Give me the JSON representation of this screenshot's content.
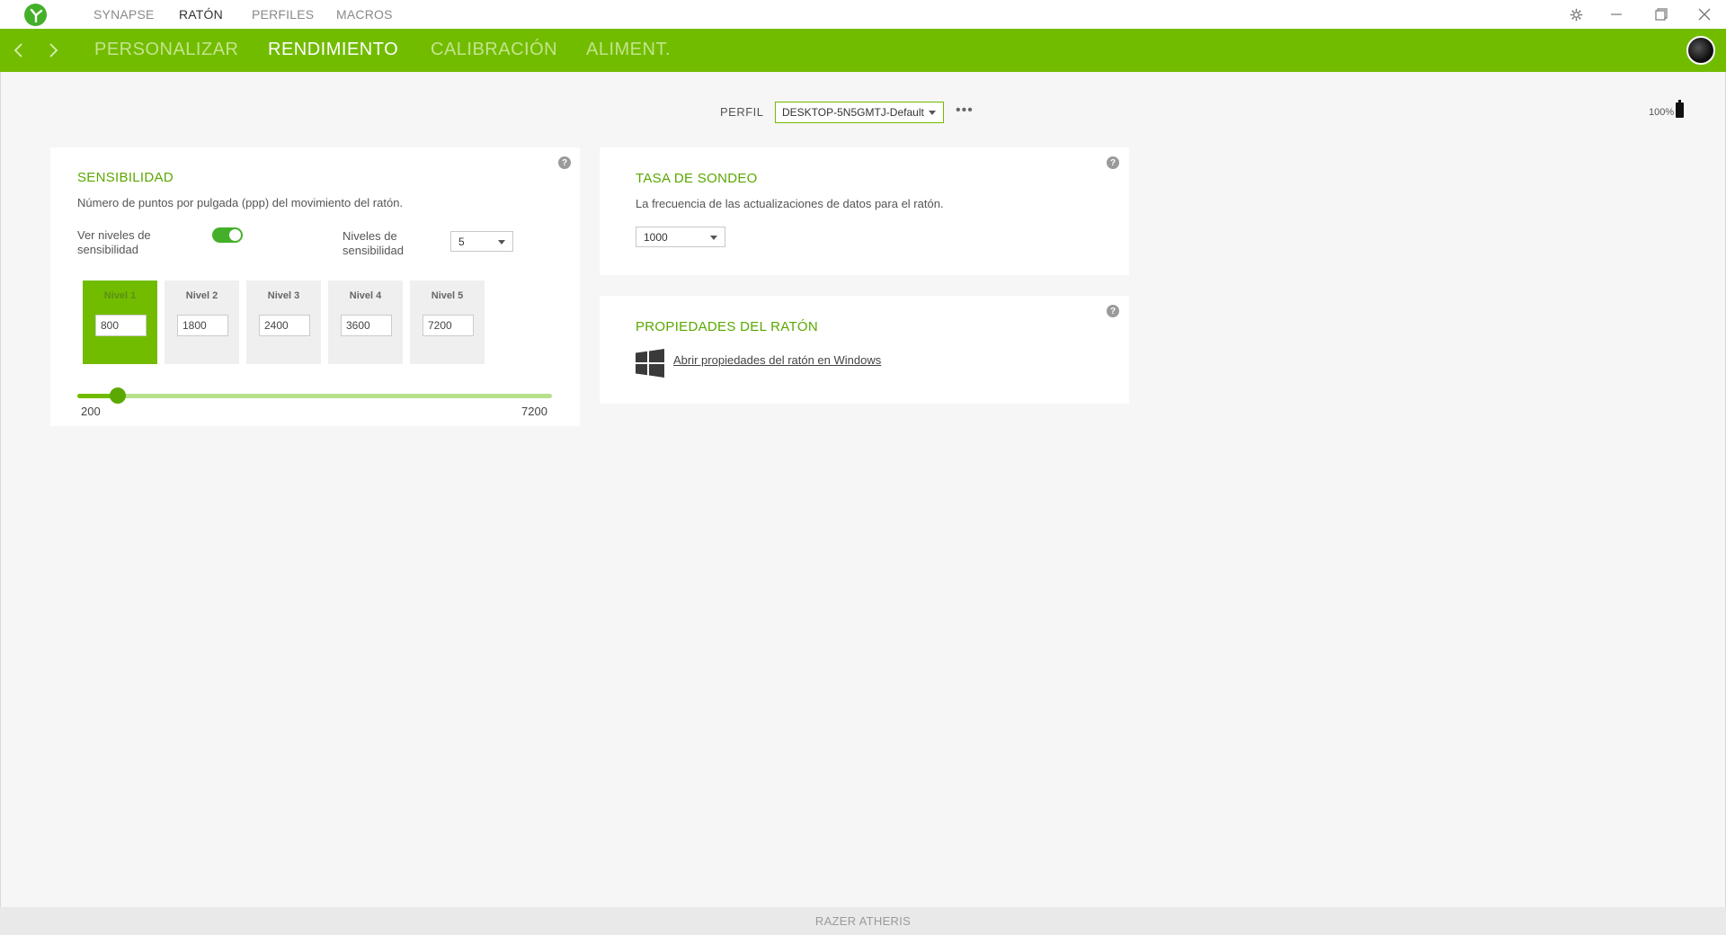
{
  "titlebar": {
    "nav": [
      {
        "label": "SYNAPSE",
        "active": false
      },
      {
        "label": "RATÓN",
        "active": true
      },
      {
        "label": "PERFILES",
        "active": false
      },
      {
        "label": "MACROS",
        "active": false
      }
    ],
    "icons": [
      "razer-logo-icon",
      "gear-icon",
      "minimize-icon",
      "restore-icon",
      "close-icon"
    ]
  },
  "header": {
    "tabs": [
      {
        "label": "PERSONALIZAR",
        "active": false
      },
      {
        "label": "RENDIMIENTO",
        "active": true
      },
      {
        "label": "CALIBRACIÓN",
        "active": false
      },
      {
        "label": "ALIMENT.",
        "active": false
      }
    ]
  },
  "profile": {
    "label": "PERFIL",
    "value": "DESKTOP-5N5GMTJ-Default",
    "more": "•••",
    "battery": "100%"
  },
  "sensitivity": {
    "title": "SENSIBILIDAD",
    "description": "Número de puntos por pulgada (ppp) del movimiento del ratón.",
    "toggle_label_1": "Ver niveles de",
    "toggle_label_2": "sensibilidad",
    "toggle_on": true,
    "levels_label_1": "Niveles de",
    "levels_label_2": "sensibilidad",
    "levels_count": "5",
    "levels": [
      {
        "label": "Nivel 1",
        "value": "800",
        "active": true
      },
      {
        "label": "Nivel 2",
        "value": "1800",
        "active": false
      },
      {
        "label": "Nivel 3",
        "value": "2400",
        "active": false
      },
      {
        "label": "Nivel 4",
        "value": "3600",
        "active": false
      },
      {
        "label": "Nivel 5",
        "value": "7200",
        "active": false
      }
    ],
    "slider": {
      "min": "200",
      "max": "7200",
      "min_value": 200,
      "max_value": 7200,
      "current": 800
    }
  },
  "polling": {
    "title": "TASA DE SONDEO",
    "description": "La frecuencia de las actualizaciones de datos para el ratón.",
    "value": "1000"
  },
  "mouse_props": {
    "title": "PROPIEDADES DEL RATÓN",
    "link": "Abrir propiedades del ratón en Windows"
  },
  "footer": {
    "device": "RAZER ATHERIS"
  },
  "colors": {
    "accent": "#72bc00",
    "accent_dark": "#44b02a",
    "title_green": "#5aa800"
  }
}
